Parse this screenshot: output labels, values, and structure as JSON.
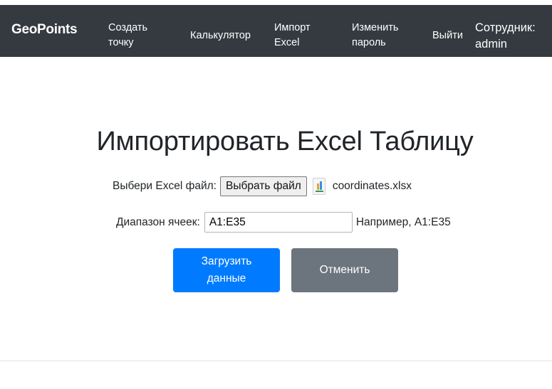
{
  "navbar": {
    "brand": "GeoPoints",
    "items": [
      {
        "label": "Создать точку"
      },
      {
        "label": "Калькулятор"
      },
      {
        "label": "Импорт Excel"
      },
      {
        "label": "Изменить пароль"
      },
      {
        "label": "Выйти"
      }
    ],
    "user_label": "Сотрудник:",
    "user_name": "admin",
    "background_color": "#343a40"
  },
  "main": {
    "title": "Импортировать Excel Таблицу",
    "file_label": "Выбери Excel файл:",
    "file_button_label": "Выбрать файл",
    "file_name": "coordinates.xlsx",
    "file_icon": "excel-file-icon",
    "range_label": "Диапазон ячеек:",
    "range_value": "A1:E35",
    "range_hint": "Например, A1:E35",
    "submit_label": "Загрузить данные",
    "cancel_label": "Отменить",
    "primary_color": "#007bff",
    "secondary_color": "#6c757d"
  }
}
